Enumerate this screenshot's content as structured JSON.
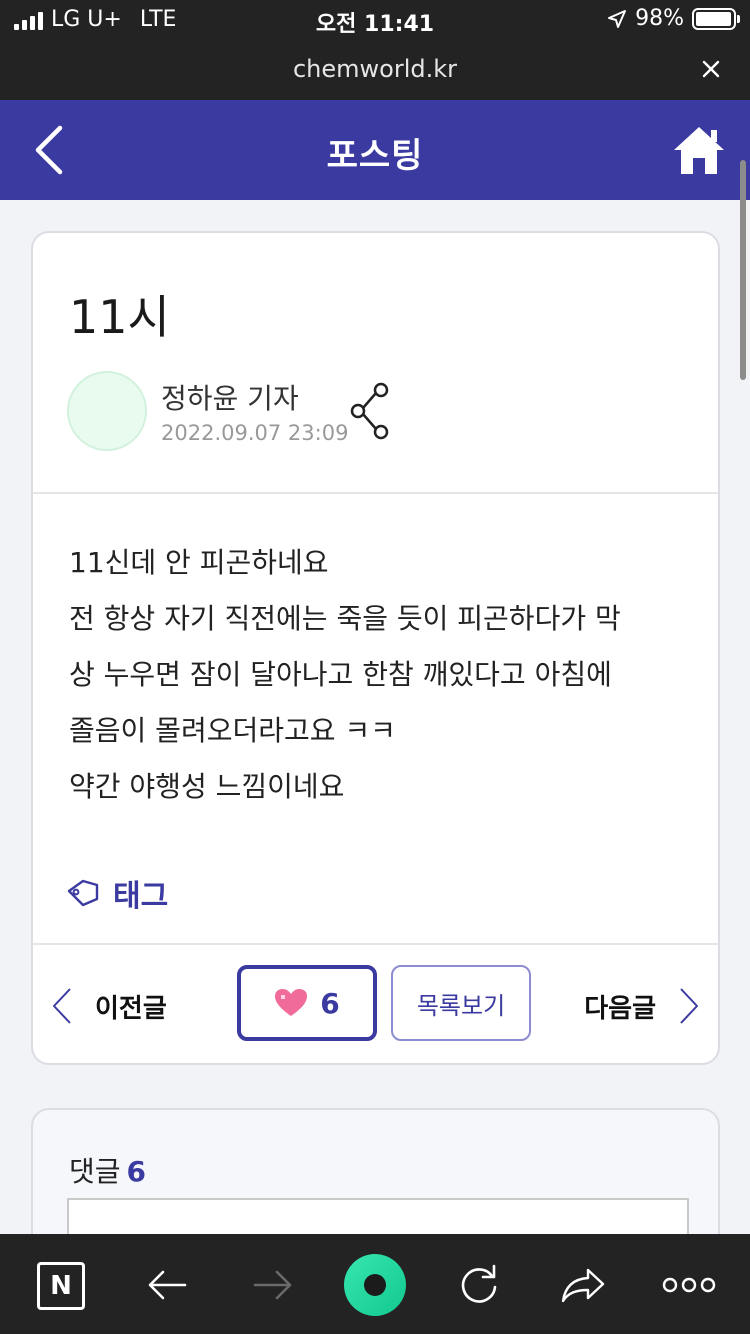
{
  "status": {
    "carrier": "LG U+",
    "network": "LTE",
    "time": "오전 11:41",
    "battery": "98%",
    "battery_level": 0.98
  },
  "browser": {
    "url": "chemworld.kr"
  },
  "header": {
    "title": "포스팅"
  },
  "post": {
    "title": "11시",
    "author": "정하윤 기자",
    "date": "2022.09.07 23:09",
    "body": [
      "11신데 안 피곤하네요",
      "전 항상 자기 직전에는 죽을 듯이 피곤하다가 막",
      "상 누우면 잠이 달아나고 한참 깨있다고 아침에",
      "졸음이 몰려오더라고요 ㅋㅋ",
      "약간 야행성 느낌이네요"
    ],
    "tag_label": "태그"
  },
  "nav": {
    "prev_label": "이전글",
    "like_count": "6",
    "list_label": "목록보기",
    "next_label": "다음글"
  },
  "comments": {
    "label": "댓글",
    "count": "6"
  },
  "colors": {
    "accent": "#3a3aa0",
    "chrome": "#232323",
    "record": "#1fd79e",
    "heart": "#f06b9a"
  }
}
